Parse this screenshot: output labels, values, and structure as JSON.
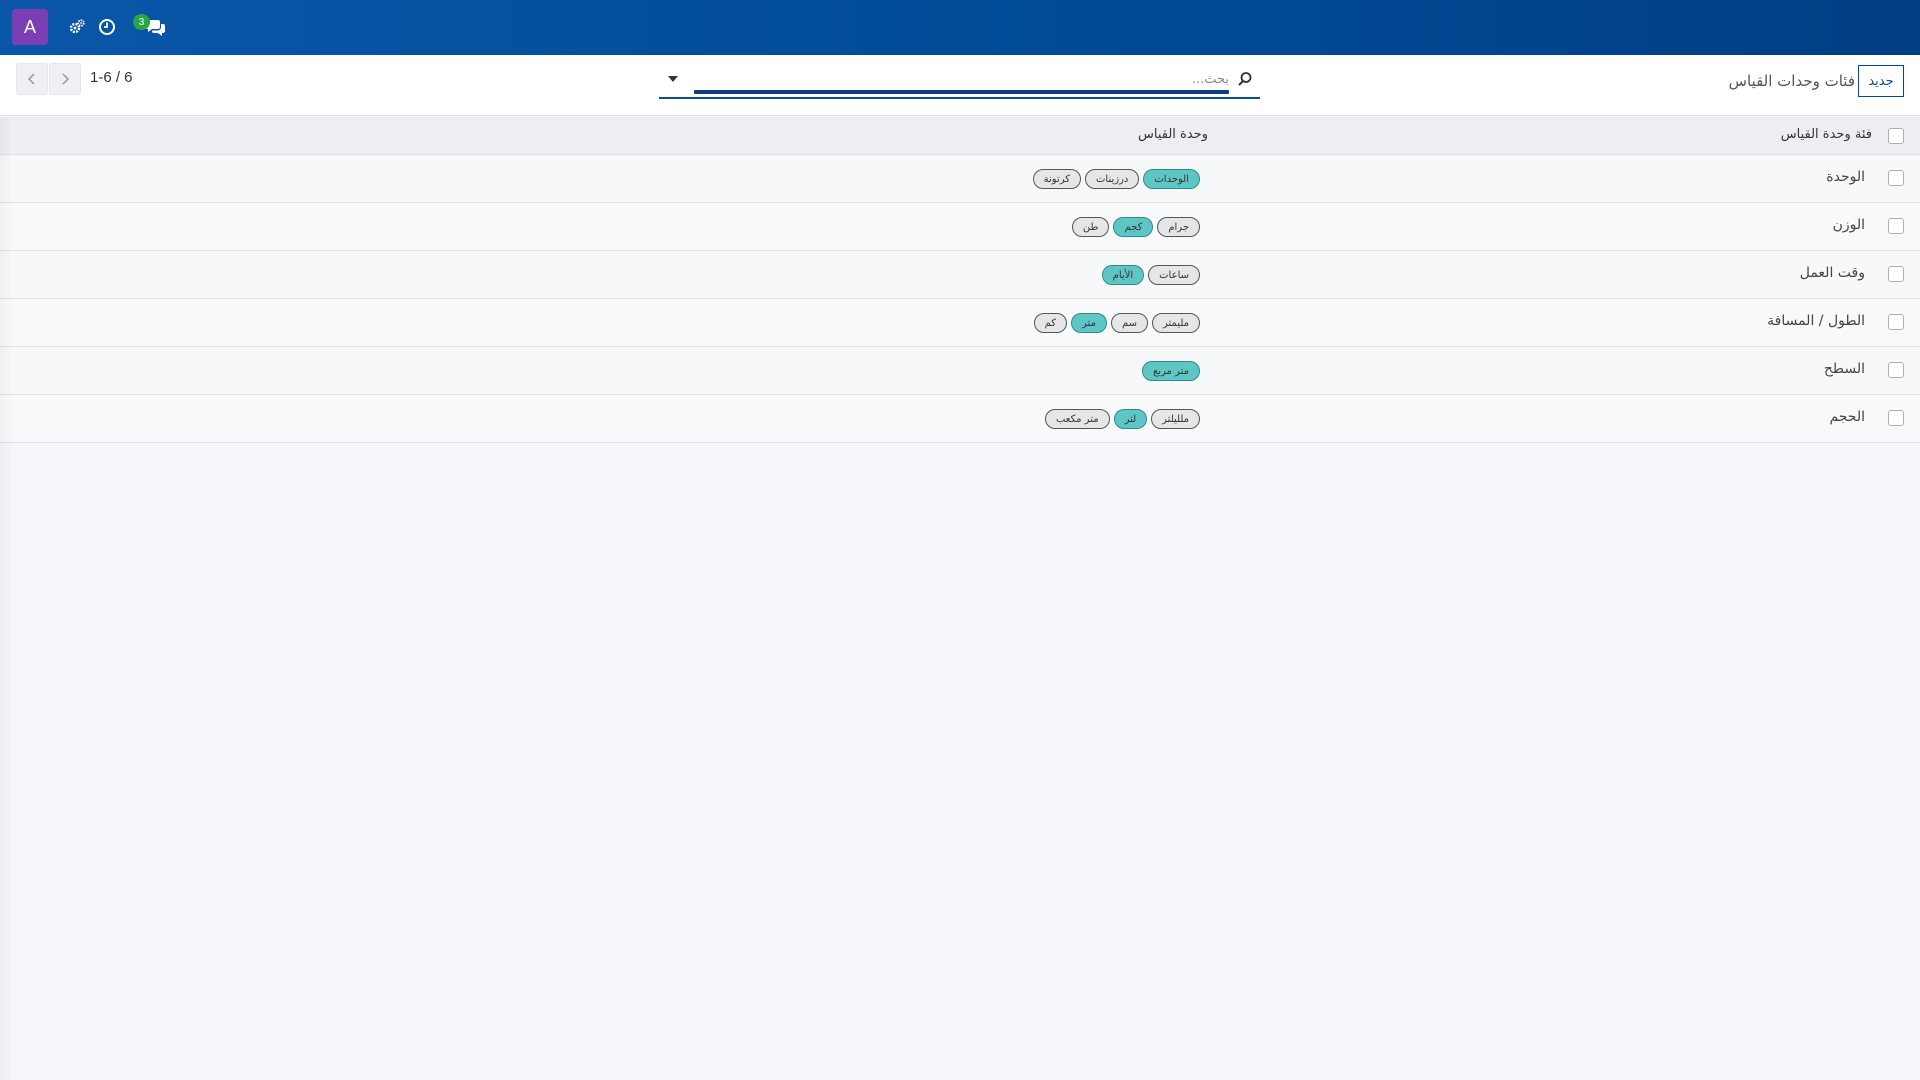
{
  "navbar": {
    "avatar_letter": "A",
    "messages_badge": "3",
    "icons": [
      "settings-gears-icon",
      "clock-icon",
      "chat-bubbles-icon"
    ],
    "colors": {
      "bar": "#0a56a8",
      "avatar": "#7b3fb4",
      "badge": "#28a745"
    }
  },
  "control_panel": {
    "new_button": "جديد",
    "breadcrumb": "فئات وحدات القياس",
    "search_placeholder": "بحث...",
    "pager": "1-6 / 6"
  },
  "table": {
    "headers": {
      "category": "فئة وحدة القياس",
      "uom": "وحدة القياس"
    },
    "rows": [
      {
        "category": "الوحدة",
        "tags": [
          {
            "label": "الوحدات",
            "ref": true
          },
          {
            "label": "درزينات",
            "ref": false
          },
          {
            "label": "كرتونة",
            "ref": false
          }
        ]
      },
      {
        "category": "الوزن",
        "tags": [
          {
            "label": "جرام",
            "ref": false
          },
          {
            "label": "كجم",
            "ref": true
          },
          {
            "label": "طن",
            "ref": false
          }
        ]
      },
      {
        "category": "وقت العمل",
        "tags": [
          {
            "label": "ساعات",
            "ref": false
          },
          {
            "label": "الأيام",
            "ref": true
          }
        ]
      },
      {
        "category": "الطول / المسافة",
        "tags": [
          {
            "label": "مليمتر",
            "ref": false
          },
          {
            "label": "سم",
            "ref": false
          },
          {
            "label": "متر",
            "ref": true
          },
          {
            "label": "كم",
            "ref": false
          }
        ]
      },
      {
        "category": "السطح",
        "tags": [
          {
            "label": "متر مربع",
            "ref": true
          }
        ]
      },
      {
        "category": "الحجم",
        "tags": [
          {
            "label": "ملليلتر",
            "ref": false
          },
          {
            "label": "لتر",
            "ref": true
          },
          {
            "label": "متر مكعب",
            "ref": false
          }
        ]
      }
    ],
    "colors": {
      "reference_tag": "#5fc6c6",
      "tag": "#e5e6e8"
    }
  }
}
